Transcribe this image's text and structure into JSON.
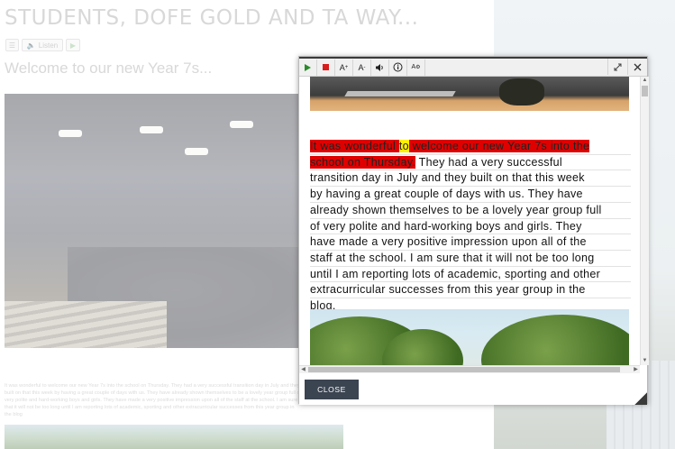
{
  "page": {
    "title": "STUDENTS, DOFE GOLD AND TA WAY...",
    "listen_label": "Listen",
    "subheading": "Welcome to our new Year 7s...",
    "paragraph": "It was wonderful to welcome our new Year 7s into the school on Thursday. They had a very successful transition day in July and they built on that this week by having a great couple of days with us. They have already shown themselves to be a lovely year group full of very polite and hard-working boys and girls. They have made a very positive impression upon all of the staff at the school. I am sure that it will not be too long until I am reporting lots of academic, sporting and other extracurricular successes from this year group in the blog"
  },
  "reader": {
    "toolbar": {
      "play_icon": "play-icon",
      "stop_icon": "stop-icon",
      "font_increase_label": "A",
      "font_decrease_label": "A",
      "volume_icon": "speaker-icon",
      "info_icon": "info-icon",
      "settings_label": "A",
      "expand_icon": "expand-icon",
      "close_icon": "close-icon"
    },
    "article": {
      "highlight_pre": "It was wonderful ",
      "highlight_word": "to",
      "highlight_post_line1": " welcome our new Year 7s into the",
      "highlight_line2": "school on Thursday.",
      "line2_rest": " They had a very successful",
      "lines": [
        "transition day in July and they built on that this week",
        "by having a great couple of days with us. They have",
        "already shown themselves to be a lovely year group full",
        "of very polite and hard-working boys and girls. They",
        "have made a very positive impression upon all of the",
        "staff at the school. I am sure that it will not be too long",
        "until I am reporting lots of academic, sporting and other",
        "extracurricular successes from this year group in the",
        "blog."
      ]
    },
    "close_label": "CLOSE",
    "colors": {
      "sentence_highlight": "#e00000",
      "word_highlight": "#ffef00",
      "close_button": "#3b4451"
    }
  }
}
